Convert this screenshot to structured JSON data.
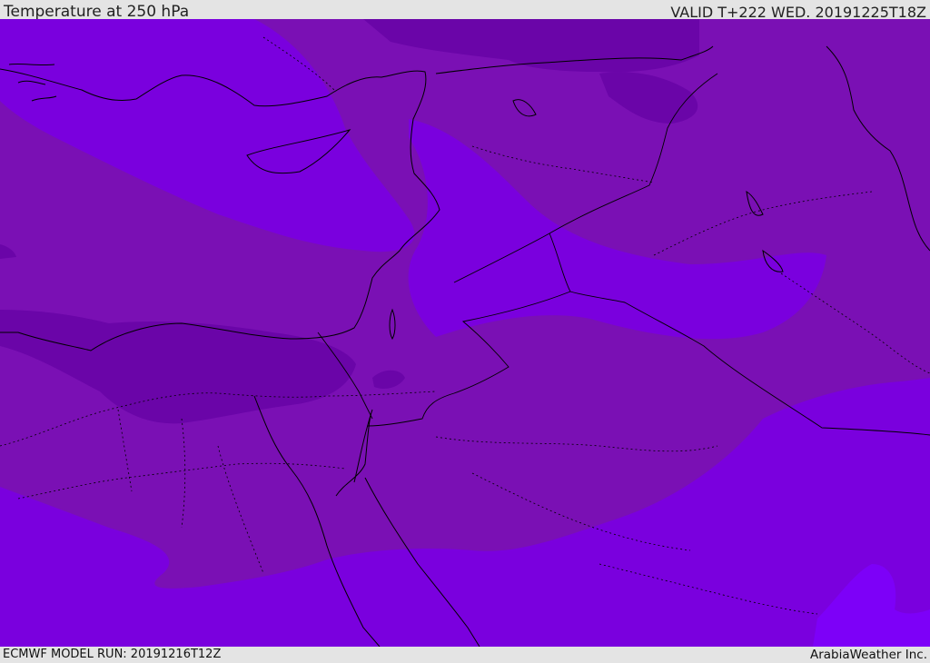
{
  "header": {
    "title": "Temperature at 250 hPa",
    "valid": "VALID T+222 WED. 20191225T18Z"
  },
  "footer": {
    "model_run": "ECMWF MODEL RUN: 20191216T12Z",
    "credit": "ArabiaWeather Inc."
  },
  "map": {
    "field": "Temperature at 250 hPa",
    "colors": {
      "band_coldest": "#6a05a8",
      "band_mid": "#7a10b4",
      "band_warm": "#7a00de",
      "band_warmest": "#7d00f8",
      "coastline": "#000000"
    }
  }
}
